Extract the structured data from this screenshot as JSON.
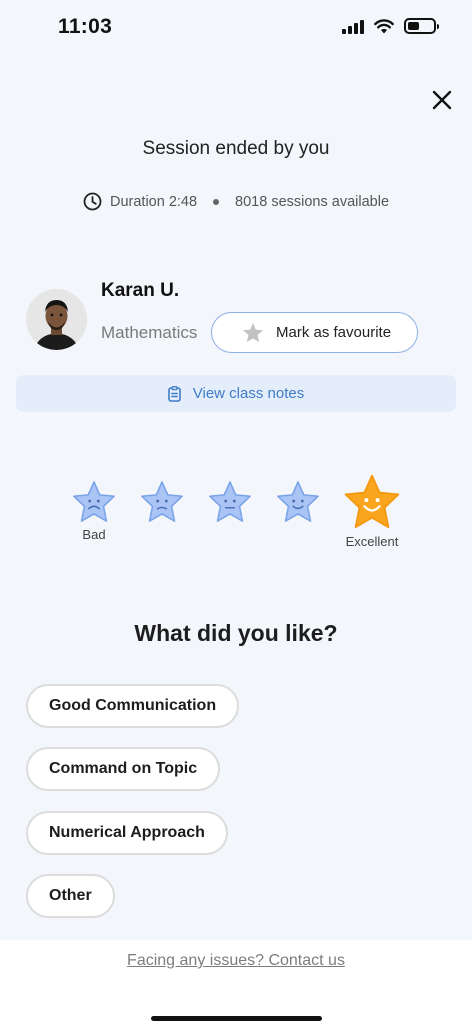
{
  "status_bar": {
    "time": "11:03",
    "battery_level": 0.45
  },
  "session": {
    "title": "Session ended by you",
    "duration": "Duration 2:48",
    "sessions_available": "8018 sessions available"
  },
  "tutor": {
    "name": "Karan U.",
    "subject": "Mathematics",
    "favourite_label": "Mark as favourite"
  },
  "notes": {
    "label": "View class notes"
  },
  "rating": {
    "low_label": "Bad",
    "high_label": "Excellent",
    "selected": 5,
    "colors": {
      "inactive": "#a9c4f5",
      "active": "#f9a51d"
    }
  },
  "likes": {
    "title": "What did you like?",
    "options": [
      "Good Communication",
      "Command on Topic",
      "Numerical Approach",
      "Other"
    ]
  },
  "footer": {
    "contact_label": "Facing any issues? Contact us"
  },
  "icons": {
    "close": "close-icon",
    "clock": "clock-icon",
    "star": "star-icon",
    "notes": "notes-icon"
  }
}
